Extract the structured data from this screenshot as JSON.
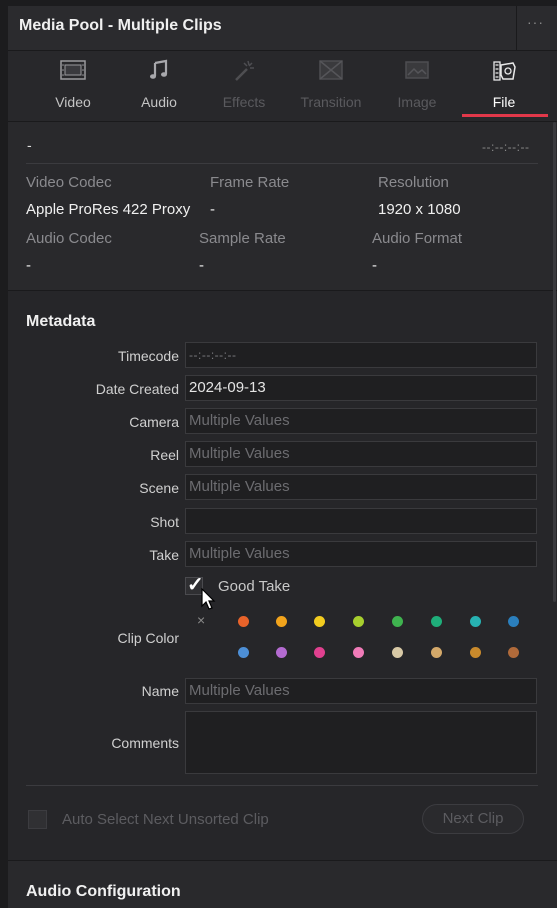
{
  "window": {
    "title": "Media Pool - Multiple Clips",
    "menu_icon": "more-dots-icon"
  },
  "tabs": [
    {
      "label": "Video",
      "icon": "film-frame-icon",
      "state": "normal"
    },
    {
      "label": "Audio",
      "icon": "music-note-icon",
      "state": "normal"
    },
    {
      "label": "Effects",
      "icon": "magic-wand-icon",
      "state": "disabled"
    },
    {
      "label": "Transition",
      "icon": "transition-icon",
      "state": "disabled"
    },
    {
      "label": "Image",
      "icon": "image-icon",
      "state": "disabled"
    },
    {
      "label": "File",
      "icon": "file-info-icon",
      "state": "active"
    }
  ],
  "file_info": {
    "clip_name": "-",
    "timecode": "--:--:--:--",
    "video_codec_label": "Video Codec",
    "video_codec": "Apple ProRes 422 Proxy",
    "frame_rate_label": "Frame Rate",
    "frame_rate": "-",
    "resolution_label": "Resolution",
    "resolution": "1920 x 1080",
    "audio_codec_label": "Audio Codec",
    "audio_codec": "-",
    "sample_rate_label": "Sample Rate",
    "sample_rate": "-",
    "audio_format_label": "Audio Format",
    "audio_format": "-"
  },
  "metadata": {
    "title": "Metadata",
    "timecode_label": "Timecode",
    "timecode_value": "--:--:--:--",
    "date_created_label": "Date Created",
    "date_created_value": "2024-09-13",
    "camera_label": "Camera",
    "camera_placeholder": "Multiple Values",
    "reel_label": "Reel",
    "reel_placeholder": "Multiple Values",
    "scene_label": "Scene",
    "scene_placeholder": "Multiple Values",
    "shot_label": "Shot",
    "shot_value": "",
    "take_label": "Take",
    "take_placeholder": "Multiple Values",
    "good_take_label": "Good Take",
    "good_take_checked": true,
    "clip_color_label": "Clip Color",
    "clip_colors": [
      "#e8632a",
      "#f2a41c",
      "#f2cc1f",
      "#a7cf2e",
      "#3fb34f",
      "#1fae7a",
      "#27b2b2",
      "#2b7fbd",
      "#4d8fd6",
      "#b46bd1",
      "#e0408f",
      "#f07bb8",
      "#d8c9a6",
      "#d4a96a",
      "#c98a2c",
      "#b06a3a"
    ],
    "name_label": "Name",
    "name_placeholder": "Multiple Values",
    "comments_label": "Comments",
    "comments_value": ""
  },
  "footer": {
    "auto_select_label": "Auto Select Next Unsorted Clip",
    "next_clip_label": "Next Clip"
  },
  "audio_config": {
    "title": "Audio Configuration"
  }
}
